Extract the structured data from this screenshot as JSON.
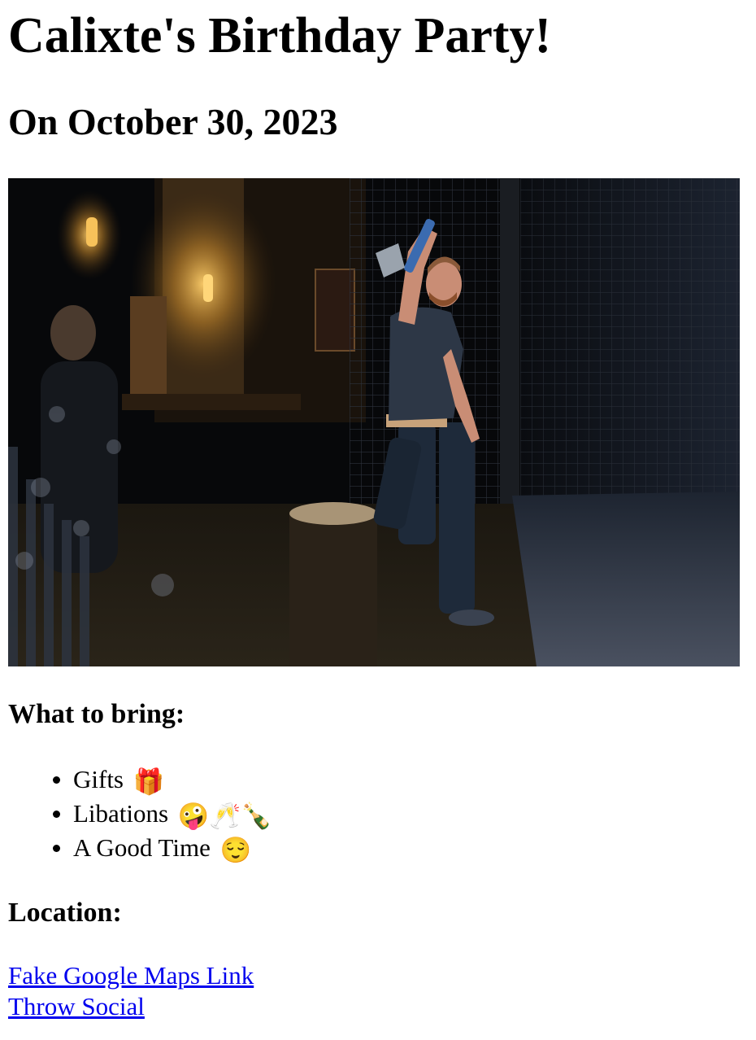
{
  "header": {
    "title": "Calixte's Birthday Party!",
    "date": "On October 30, 2023"
  },
  "photo": {
    "description_icon": "party-photo-axe-throwing"
  },
  "bring": {
    "heading": "What to bring:",
    "items": [
      {
        "label": "Gifts",
        "emoji": "🎁"
      },
      {
        "label": "Libations",
        "emoji": "🤪🥂🍾"
      },
      {
        "label": "A Good Time",
        "emoji": "😌"
      }
    ]
  },
  "location": {
    "heading": "Location:",
    "links": [
      "Fake Google Maps Link",
      "Throw Social"
    ]
  }
}
